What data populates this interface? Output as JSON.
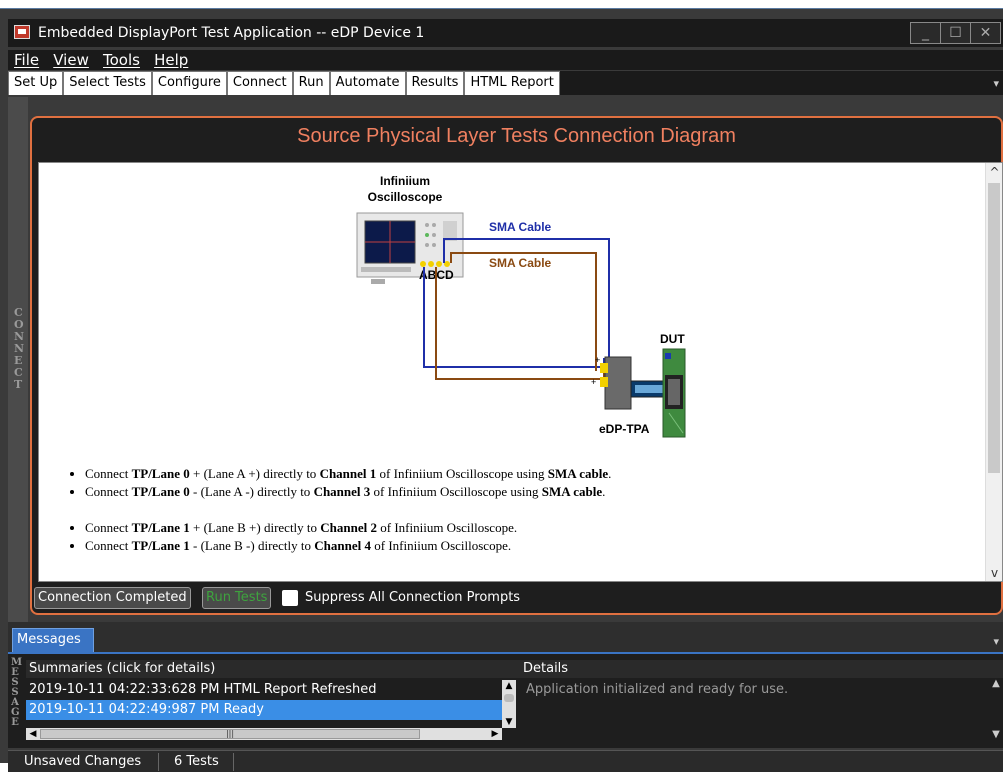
{
  "window": {
    "title": "Embedded DisplayPort Test Application -- eDP Device 1"
  },
  "menu": [
    "File",
    "View",
    "Tools",
    "Help"
  ],
  "tabs": [
    "Set Up",
    "Select Tests",
    "Configure",
    "Connect",
    "Run",
    "Automate",
    "Results",
    "HTML Report"
  ],
  "active_tab": "Connect",
  "side_label": "CONNECT",
  "panel": {
    "title": "Source Physical Layer Tests Connection Diagram"
  },
  "diagram": {
    "scope_line1": "Infiniium",
    "scope_line2": "Oscilloscope",
    "channels": "ABCD",
    "cable1": "SMA Cable",
    "cable2": "SMA Cable",
    "dut": "DUT",
    "tpa": "eDP-TPA",
    "cable1_color": "#1f2fa8",
    "cable2_color": "#8a4a12"
  },
  "instructions": [
    {
      "pre": "Connect ",
      "b1": "TP/Lane 0",
      "mid": " + (Lane A +) directly to ",
      "b2": "Channel 1",
      "post": " of Infiniium Oscilloscope using ",
      "b3": "SMA cable",
      "end": "."
    },
    {
      "pre": "Connect ",
      "b1": "TP/Lane 0",
      "mid": " - (Lane A -) directly to ",
      "b2": "Channel 3",
      "post": " of Infiniium Oscilloscope using ",
      "b3": "SMA cable",
      "end": "."
    },
    {
      "pre": "Connect ",
      "b1": "TP/Lane 1",
      "mid": " + (Lane B +) directly to ",
      "b2": "Channel 2",
      "post": " of Infiniium Oscilloscope.",
      "b3": "",
      "end": ""
    },
    {
      "pre": "Connect ",
      "b1": "TP/Lane 1",
      "mid": " - (Lane B -) directly to ",
      "b2": "Channel 4",
      "post": " of Infiniium Oscilloscope.",
      "b3": "",
      "end": ""
    }
  ],
  "footer": {
    "connection_completed": "Connection Completed",
    "run_tests": "Run Tests",
    "suppress": "Suppress All Connection Prompts"
  },
  "messages": {
    "tab": "Messages",
    "side_label": "MESSAGE",
    "summaries_header": "Summaries (click for details)",
    "details_header": "Details",
    "rows": [
      {
        "text": "2019-10-11 04:22:33:628 PM HTML Report Refreshed",
        "selected": false
      },
      {
        "text": "2019-10-11 04:22:49:987 PM Ready",
        "selected": true
      }
    ],
    "details_text": "Application initialized and ready for use."
  },
  "status": {
    "unsaved": "Unsaved Changes",
    "tests": "6 Tests"
  }
}
